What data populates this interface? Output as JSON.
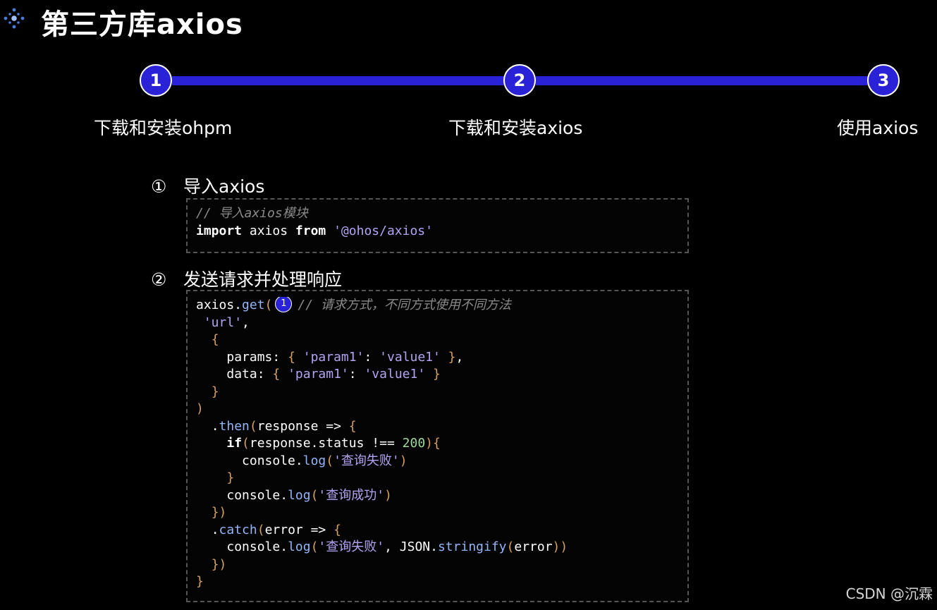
{
  "slide": {
    "title": "第三方库axios",
    "logo_icon": "sparkle-diamond-icon"
  },
  "steps": [
    {
      "number": "1",
      "label": "下载和安装ohpm"
    },
    {
      "number": "2",
      "label": "下载和安装axios"
    },
    {
      "number": "3",
      "label": "使用axios"
    }
  ],
  "sections": [
    {
      "number": "①",
      "heading": "导入axios",
      "code": {
        "comment": "// 导入axios模块",
        "kw_import": "import",
        "ident": " axios ",
        "kw_from": "from",
        "space": " ",
        "module": "'@ohos/axios'"
      }
    },
    {
      "number": "②",
      "heading": "发送请求并处理响应",
      "code": {
        "l1_obj": "axios.",
        "l1_fn": "get",
        "l1_paren": "(",
        "l1_badge": "1",
        "l1_comment": "// 请求方式，不同方式使用不同方法",
        "l2_str": "'url'",
        "l2_comma": ",",
        "l3_brace": "{",
        "l4_key": "params: ",
        "l4_ob": "{ ",
        "l4_k": "'param1'",
        "l4_colon": ": ",
        "l4_v": "'value1'",
        "l4_cb": " }",
        "l4_end": ",",
        "l5_key": "data: ",
        "l5_ob": "{ ",
        "l5_k": "'param1'",
        "l5_colon": ": ",
        "l5_v": "'value1'",
        "l5_cb": " }",
        "l6_brace": "}",
        "l7_paren": ")",
        "l8_dot": ".",
        "l8_fn": "then",
        "l8_op": "(",
        "l8_rest": "response => ",
        "l8_brace": "{",
        "l9_kw": "if",
        "l9_op": "(",
        "l9_mid": "response.status !== ",
        "l9_num": "200",
        "l9_cl": ")",
        "l9_brace": "{",
        "l10_obj": "console.",
        "l10_fn": "log",
        "l10_op": "(",
        "l10_str": "'查询失败'",
        "l10_cl": ")",
        "l11_brace": "}",
        "l12_obj": "console.",
        "l12_fn": "log",
        "l12_op": "(",
        "l12_str": "'查询成功'",
        "l12_cl": ")",
        "l13_close": "})",
        "l14_dot": ".",
        "l14_fn": "catch",
        "l14_op": "(",
        "l14_rest": "error => ",
        "l14_brace": "{",
        "l15_obj": "console.",
        "l15_fn": "log",
        "l15_op": "(",
        "l15_str": "'查询失败'",
        "l15_mid": ", JSON.",
        "l15_fn2": "stringify",
        "l15_op2": "(",
        "l15_arg": "error",
        "l15_cl": "))",
        "l16_close": "})",
        "l17_brace": "}"
      }
    }
  ],
  "watermark": "CSDN @沉霖",
  "colors": {
    "accent": "#2a22d6",
    "string": "#b4a3f3",
    "function": "#94b6f7",
    "punctuation": "#d7a063",
    "number": "#9ed99a",
    "comment": "#8a8a8a"
  }
}
